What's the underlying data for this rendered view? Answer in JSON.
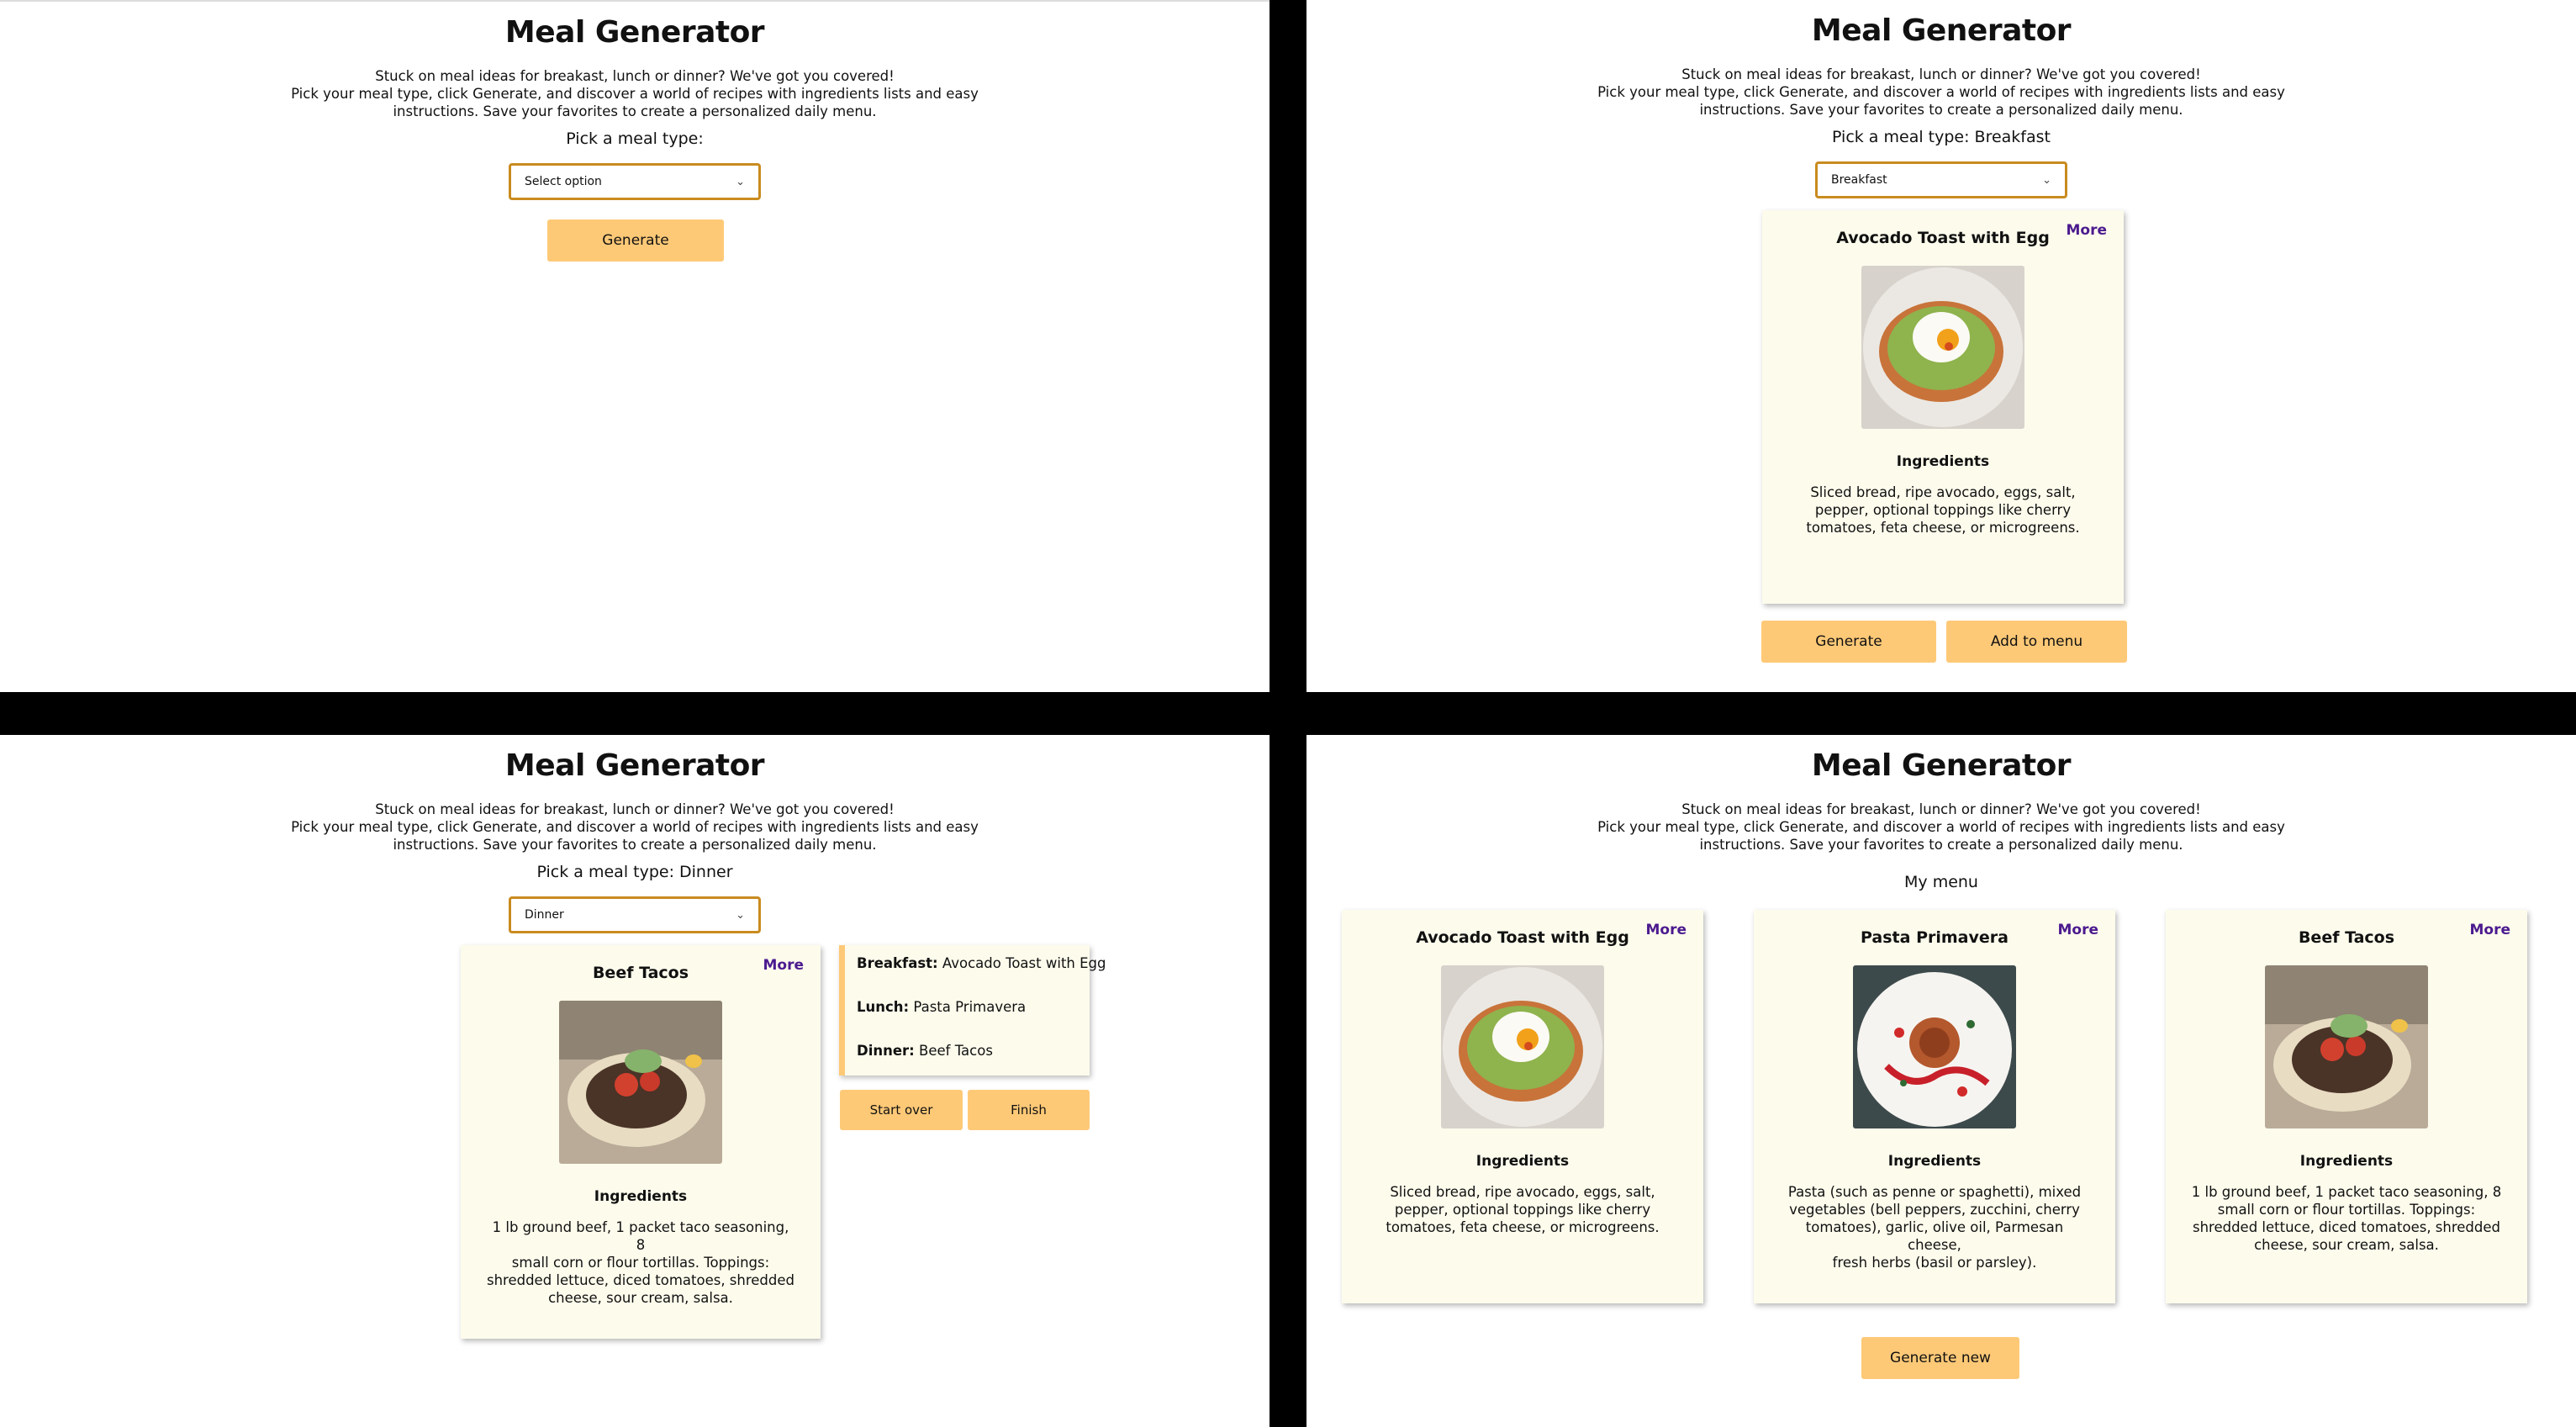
{
  "app": {
    "title": "Meal Generator",
    "intro_lines": [
      "Stuck on meal ideas for breakast, lunch or dinner? We've got you covered!",
      "Pick your meal type, click Generate, and discover a world of recipes with ingredients lists and easy",
      "instructions. Save your favorites to create a personalized daily menu."
    ],
    "accent_color": "#fec977",
    "card_bg": "#fdfbec",
    "link_color": "#4b1a8f"
  },
  "screen1": {
    "pick_label": "Pick a meal type:",
    "select_value": "Select option",
    "generate_label": "Generate"
  },
  "screen2": {
    "pick_label": "Pick a meal type: Breakfast",
    "select_value": "Breakfast",
    "card": {
      "title": "Avocado Toast with Egg",
      "more": "More",
      "image_icon": "avocado-toast-image",
      "ingredients_title": "Ingredients",
      "ingredients_lines": [
        "Sliced bread, ripe avocado, eggs, salt,",
        "pepper, optional toppings like cherry",
        "tomatoes, feta cheese, or microgreens."
      ]
    },
    "generate_label": "Generate",
    "add_label": "Add to menu"
  },
  "screen3": {
    "pick_label": "Pick a meal type: Dinner",
    "select_value": "Dinner",
    "card": {
      "title": "Beef Tacos",
      "more": "More",
      "image_icon": "beef-tacos-image",
      "ingredients_title": "Ingredients",
      "ingredients_lines": [
        "1 lb ground beef, 1 packet taco seasoning, 8",
        "small corn or flour tortillas. Toppings:",
        "shredded lettuce, diced tomatoes, shredded",
        "cheese, sour cream, salsa."
      ]
    },
    "summary": [
      {
        "label": "Breakfast:",
        "value": "Avocado Toast with Egg"
      },
      {
        "label": "Lunch:",
        "value": "Pasta Primavera"
      },
      {
        "label": "Dinner:",
        "value": "Beef Tacos"
      }
    ],
    "start_over_label": "Start over",
    "finish_label": "Finish"
  },
  "screen4": {
    "menu_heading": "My menu",
    "cards": [
      {
        "title": "Avocado Toast with Egg",
        "more": "More",
        "image_icon": "avocado-toast-image",
        "ingredients_title": "Ingredients",
        "ingredients_lines": [
          "Sliced bread, ripe avocado, eggs, salt,",
          "pepper, optional toppings like cherry",
          "tomatoes, feta cheese, or microgreens."
        ]
      },
      {
        "title": "Pasta Primavera",
        "more": "More",
        "image_icon": "pasta-primavera-image",
        "ingredients_title": "Ingredients",
        "ingredients_lines": [
          "Pasta (such as penne or spaghetti), mixed",
          "vegetables (bell peppers, zucchini, cherry",
          "tomatoes), garlic, olive oil, Parmesan cheese,",
          "fresh herbs (basil or parsley)."
        ]
      },
      {
        "title": "Beef Tacos",
        "more": "More",
        "image_icon": "beef-tacos-image",
        "ingredients_title": "Ingredients",
        "ingredients_lines": [
          "1 lb ground beef, 1 packet taco seasoning, 8",
          "small corn or flour tortillas. Toppings:",
          "shredded lettuce, diced tomatoes, shredded",
          "cheese, sour cream, salsa."
        ]
      }
    ],
    "generate_new_label": "Generate new"
  }
}
